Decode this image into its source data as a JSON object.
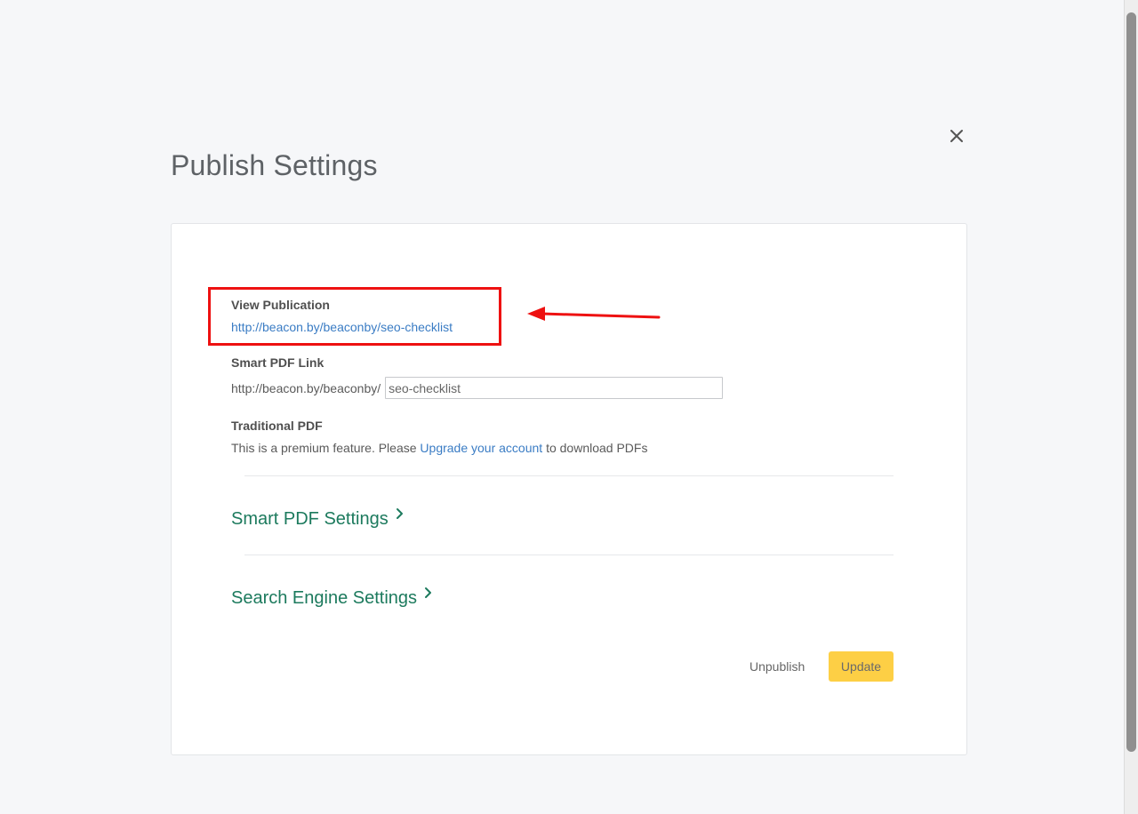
{
  "dialog": {
    "title": "Publish Settings",
    "close_icon": "close-icon"
  },
  "view_publication": {
    "label": "View Publication",
    "url": "http://beacon.by/beaconby/seo-checklist"
  },
  "smart_pdf_link": {
    "label": "Smart PDF Link",
    "prefix": "http://beacon.by/beaconby/",
    "value": "seo-checklist"
  },
  "traditional_pdf": {
    "label": "Traditional PDF",
    "text_before": "This is a premium feature. Please ",
    "link_text": "Upgrade your account",
    "text_after": " to download PDFs"
  },
  "sections": {
    "smart_pdf_settings": "Smart PDF Settings",
    "search_engine_settings": "Search Engine Settings"
  },
  "actions": {
    "unpublish": "Unpublish",
    "update": "Update"
  },
  "colors": {
    "accent_green": "#1c7a5d",
    "link_blue": "#3a7cc4",
    "update_yellow": "#fdcf45",
    "annotation_red": "#ee1111"
  }
}
